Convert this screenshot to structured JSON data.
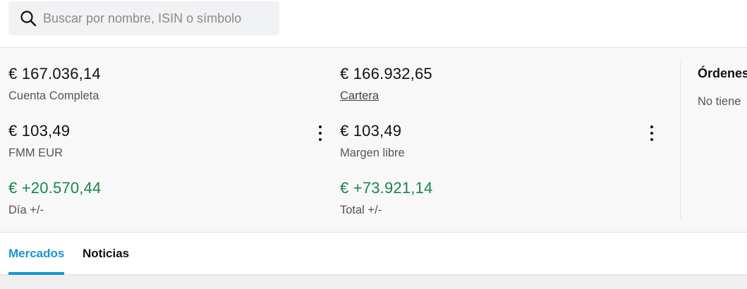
{
  "search": {
    "placeholder": "Buscar por nombre, ISIN o símbolo",
    "icon": "search-icon"
  },
  "summary": {
    "left": [
      {
        "value": "€ 167.036,14",
        "label": "Cuenta Completa"
      },
      {
        "value": "€ 103,49",
        "label": "FMM EUR"
      },
      {
        "value": "€ +20.570,44",
        "label": "Día +/-"
      }
    ],
    "right": [
      {
        "value": "€ 166.932,65",
        "label": "Cartera"
      },
      {
        "value": "€ 103,49",
        "label": "Margen libre"
      },
      {
        "value": "€ +73.921,14",
        "label": "Total +/-"
      }
    ],
    "positive_color": "#17864b"
  },
  "orders": {
    "title": "Órdenes",
    "empty_text": "No tiene"
  },
  "tabs": [
    {
      "label": "Mercados",
      "active": true
    },
    {
      "label": "Noticias",
      "active": false
    }
  ],
  "accent_color": "#1a94d6"
}
